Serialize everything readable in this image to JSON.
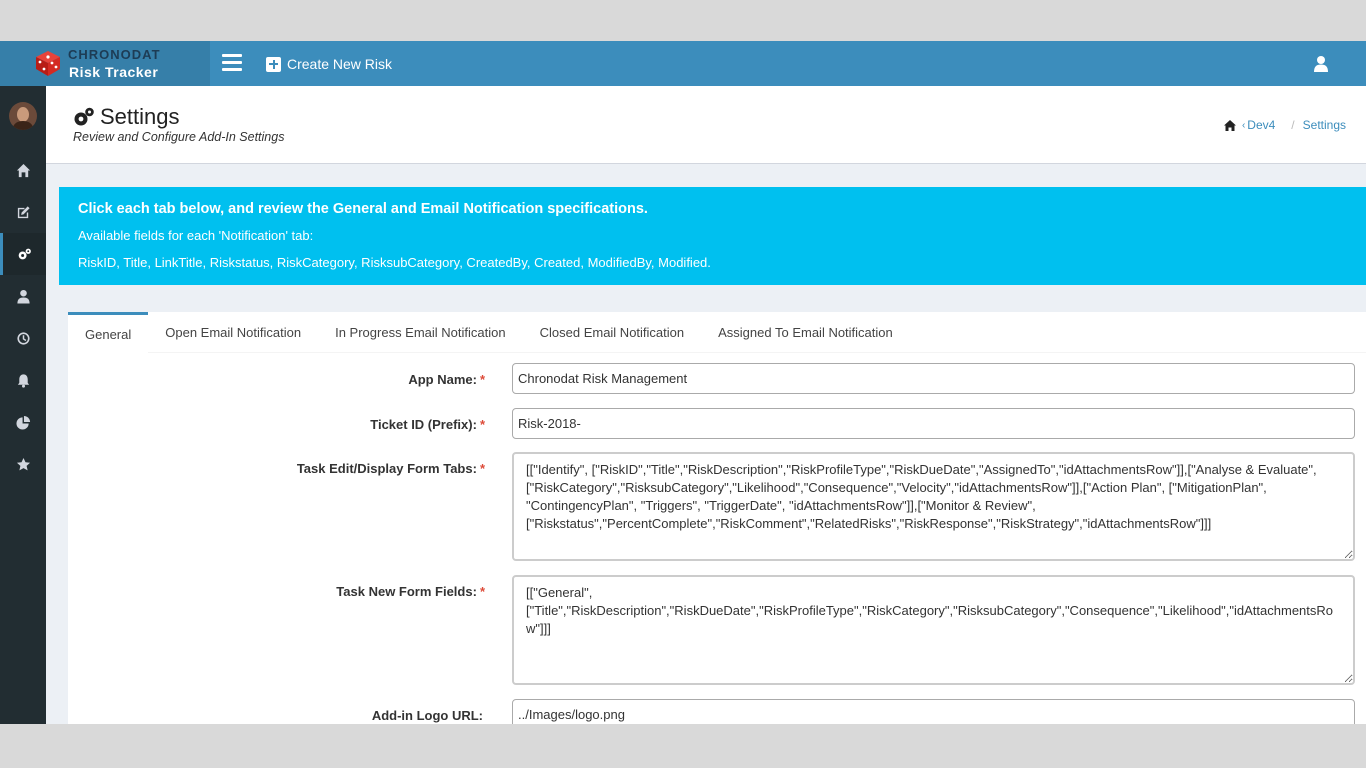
{
  "header": {
    "logo_line1": "CHRONODAT",
    "logo_line2": "Risk Tracker",
    "create_label": "Create New Risk",
    "icons": {
      "menu": "bars-icon",
      "create": "plus-square-icon",
      "user": "user-icon"
    }
  },
  "sidebar": {
    "items": [
      {
        "icon": "home-icon"
      },
      {
        "icon": "edit-icon"
      },
      {
        "icon": "cogs-icon",
        "active": true
      },
      {
        "icon": "user-icon"
      },
      {
        "icon": "clock-icon"
      },
      {
        "icon": "bell-icon"
      },
      {
        "icon": "pie-chart-icon"
      },
      {
        "icon": "star-icon"
      }
    ]
  },
  "page": {
    "title": "Settings",
    "subtitle": "Review and Configure Add-In Settings"
  },
  "breadcrumb": {
    "items": [
      "Dev4",
      "Settings"
    ]
  },
  "callout": {
    "title": "Click each tab below, and review the General and Email Notification specifications.",
    "line1": "Available fields for each 'Notification' tab:",
    "line2": "RiskID, Title, LinkTitle, Riskstatus, RiskCategory, RisksubCategory, CreatedBy, Created, ModifiedBy, Modified."
  },
  "tabs": [
    {
      "label": "General",
      "active": true
    },
    {
      "label": "Open Email Notification"
    },
    {
      "label": "In Progress Email Notification"
    },
    {
      "label": "Closed Email Notification"
    },
    {
      "label": "Assigned To Email Notification"
    }
  ],
  "form": {
    "app_name": {
      "label": "App Name:",
      "value": "Chronodat Risk Management"
    },
    "ticket_prefix": {
      "label": "Ticket ID (Prefix):",
      "value": "Risk-2018-"
    },
    "task_form_tabs": {
      "label": "Task Edit/Display Form Tabs:",
      "value": "[[\"Identify\", [\"RiskID\",\"Title\",\"RiskDescription\",\"RiskProfileType\",\"RiskDueDate\",\"AssignedTo\",\"idAttachmentsRow\"]],[\"Analyse & Evaluate\", [\"RiskCategory\",\"RisksubCategory\",\"Likelihood\",\"Consequence\",\"Velocity\",\"idAttachmentsRow\"]],[\"Action Plan\", [\"MitigationPlan\", \"ContingencyPlan\", \"Triggers\", \"TriggerDate\", \"idAttachmentsRow\"]],[\"Monitor & Review\", [\"Riskstatus\",\"PercentComplete\",\"RiskComment\",\"RelatedRisks\",\"RiskResponse\",\"RiskStrategy\",\"idAttachmentsRow\"]]]"
    },
    "task_new_fields": {
      "label": "Task New Form Fields:",
      "value": "[[\"General\", [\"Title\",\"RiskDescription\",\"RiskDueDate\",\"RiskProfileType\",\"RiskCategory\",\"RisksubCategory\",\"Consequence\",\"Likelihood\",\"idAttachmentsRow\"]]]"
    },
    "logo_url": {
      "label": "Add-in Logo URL:",
      "value": "../Images/logo.png"
    }
  },
  "colors": {
    "header": "#3c8dbc",
    "header_logo_bg": "#367fa9",
    "sidebar": "#222d32",
    "callout": "#00c0ef",
    "required": "#dd4b39"
  }
}
